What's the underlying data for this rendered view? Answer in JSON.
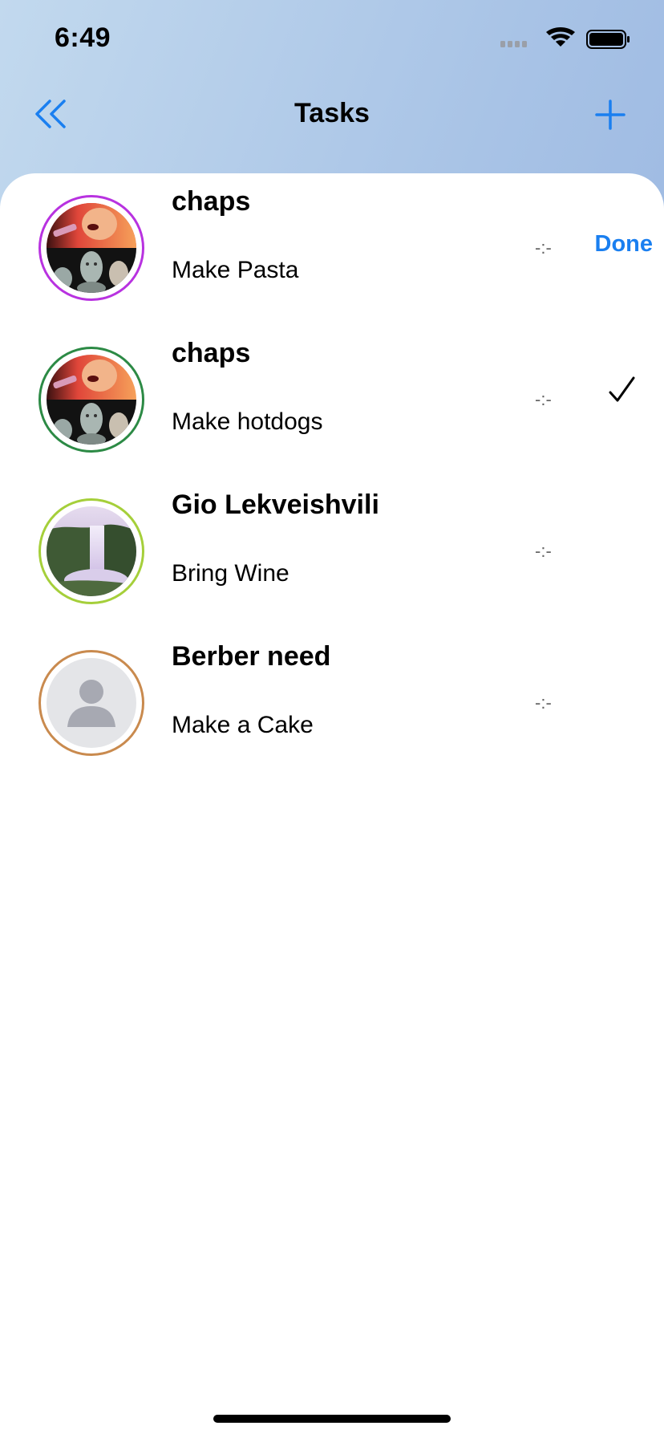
{
  "status_bar": {
    "time": "6:49"
  },
  "nav": {
    "title": "Tasks",
    "back_icon": "double-chevron-left-icon",
    "add_icon": "plus-icon"
  },
  "colors": {
    "accent": "#1a7ff0",
    "ring_purple": "#b832e0",
    "ring_green": "#2c8a45",
    "ring_lime": "#a5cf3a",
    "ring_tan": "#c98a4e"
  },
  "tasks": [
    {
      "owner": "chaps",
      "title": "Make Pasta",
      "time": "-:-",
      "action_label": "Done",
      "avatar": "collage-photo"
    },
    {
      "owner": "chaps",
      "title": "Make hotdogs",
      "time": "-:-",
      "status_icon": "checkmark-icon",
      "avatar": "collage-photo"
    },
    {
      "owner": "Gio Lekveishvili",
      "title": "Bring Wine",
      "time": "-:-",
      "avatar": "waterfall-photo"
    },
    {
      "owner": "Berber need",
      "title": "Make a Cake",
      "time": "-:-",
      "avatar": "default-person-avatar"
    }
  ]
}
